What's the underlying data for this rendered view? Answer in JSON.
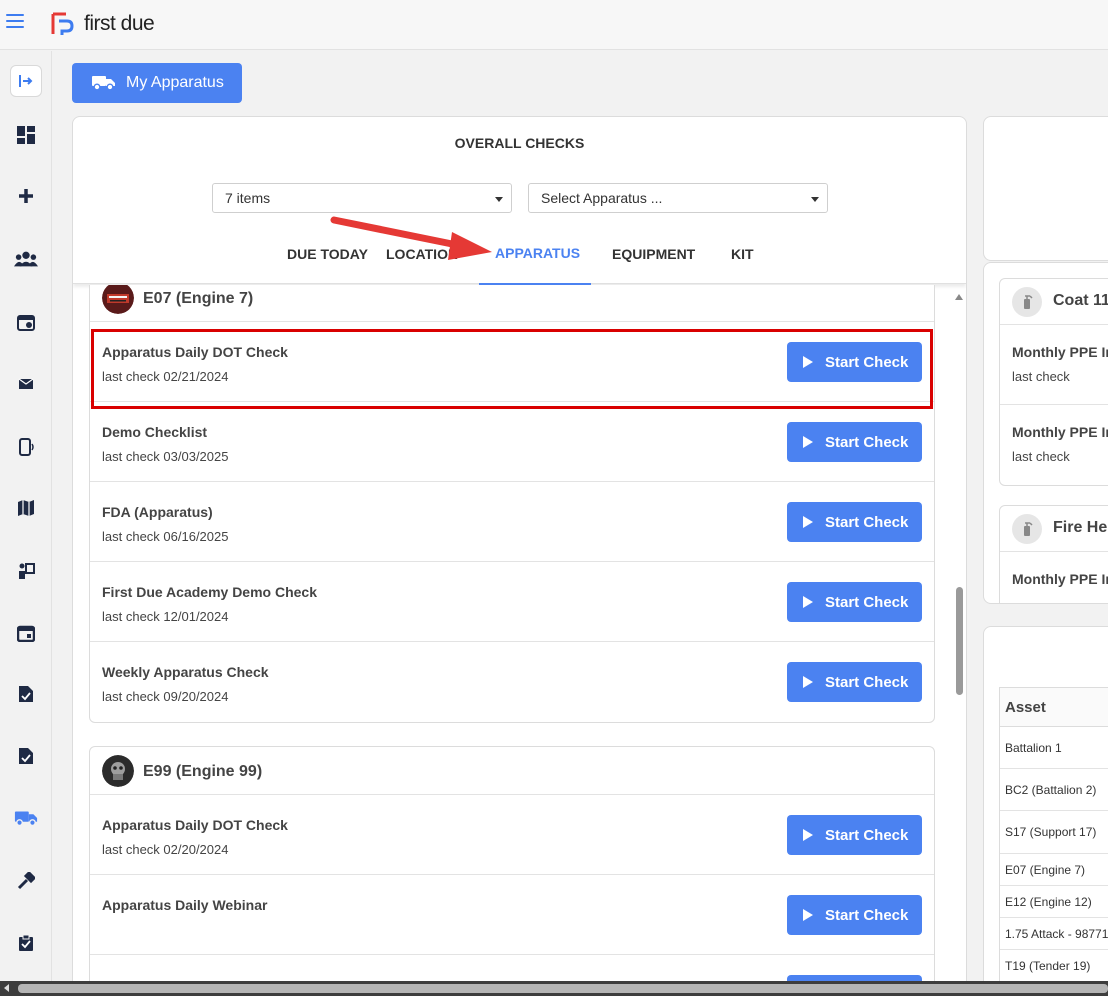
{
  "app": {
    "logo_text": "first due"
  },
  "header": {
    "my_apparatus_label": "My Apparatus"
  },
  "sidebar": {
    "items": [
      "sidebar-toggle",
      "dashboard",
      "add",
      "people",
      "calendar-user",
      "mail-check",
      "mobile-signal",
      "map",
      "training",
      "calendar",
      "file-check",
      "file-check-2",
      "apparatus",
      "tools",
      "clipboard-check"
    ]
  },
  "main": {
    "title": "OVERALL CHECKS",
    "items_select": "7 items",
    "apparatus_select_placeholder": "Select Apparatus ...",
    "tabs": [
      {
        "label": "DUE TODAY"
      },
      {
        "label": "LOCATION"
      },
      {
        "label": "APPARATUS"
      },
      {
        "label": "EQUIPMENT"
      },
      {
        "label": "KIT"
      }
    ],
    "active_tab": "APPARATUS",
    "groups": [
      {
        "title": "E07 (Engine 7)",
        "rows": [
          {
            "title": "Apparatus Daily DOT Check",
            "sub": "last check 02/21/2024",
            "button": "Start Check"
          },
          {
            "title": "Demo Checklist",
            "sub": "last check 03/03/2025",
            "button": "Start Check"
          },
          {
            "title": "FDA (Apparatus)",
            "sub": "last check 06/16/2025",
            "button": "Start Check"
          },
          {
            "title": "First Due Academy Demo Check",
            "sub": "last check 12/01/2024",
            "button": "Start Check"
          },
          {
            "title": "Weekly Apparatus Check",
            "sub": "last check 09/20/2024",
            "button": "Start Check"
          }
        ]
      },
      {
        "title": "E99 (Engine 99)",
        "rows": [
          {
            "title": "Apparatus Daily DOT Check",
            "sub": "last check 02/20/2024",
            "button": "Start Check"
          },
          {
            "title": "Apparatus Daily Webinar",
            "sub": "",
            "button": "Start Check"
          },
          {
            "title": "",
            "sub": "",
            "button": ""
          }
        ]
      }
    ]
  },
  "right": {
    "ppe_cards": [
      {
        "title": "Coat 11",
        "rows": [
          {
            "title": "Monthly PPE In",
            "sub": "last check"
          },
          {
            "title": "Monthly PPE In",
            "sub": "last check"
          }
        ]
      },
      {
        "title": "Fire He",
        "rows": [
          {
            "title": "Monthly PPE In",
            "sub": ""
          }
        ]
      }
    ],
    "asset_table": {
      "header": "Asset",
      "rows": [
        "Battalion 1",
        "BC2 (Battalion 2)",
        "S17 (Support 17)",
        "E07 (Engine 7)",
        "E12 (Engine 12)",
        "1.75 Attack - 98771",
        "T19 (Tender 19)"
      ]
    }
  },
  "colors": {
    "accent": "#4b82f1",
    "highlight": "#d90000",
    "arrow": "#e53935"
  }
}
